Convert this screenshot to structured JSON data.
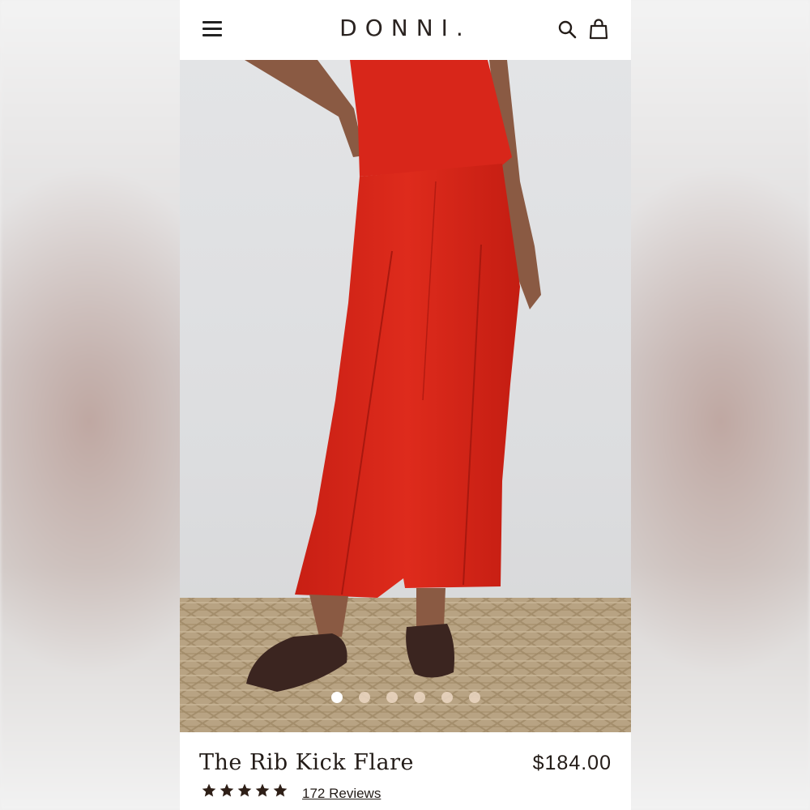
{
  "brand": {
    "logo_text": "DONNI."
  },
  "header": {
    "menu_icon": "hamburger-menu-icon",
    "search_icon": "search-icon",
    "cart_icon": "shopping-bag-icon"
  },
  "gallery": {
    "image_count": 6,
    "active_index": 0
  },
  "product": {
    "title": "The Rib Kick Flare",
    "price": "$184.00",
    "rating": 5,
    "reviews_label": "172 Reviews"
  },
  "colors": {
    "pants": "#d8261a",
    "shoes": "#3b2520",
    "text": "#231c18"
  }
}
